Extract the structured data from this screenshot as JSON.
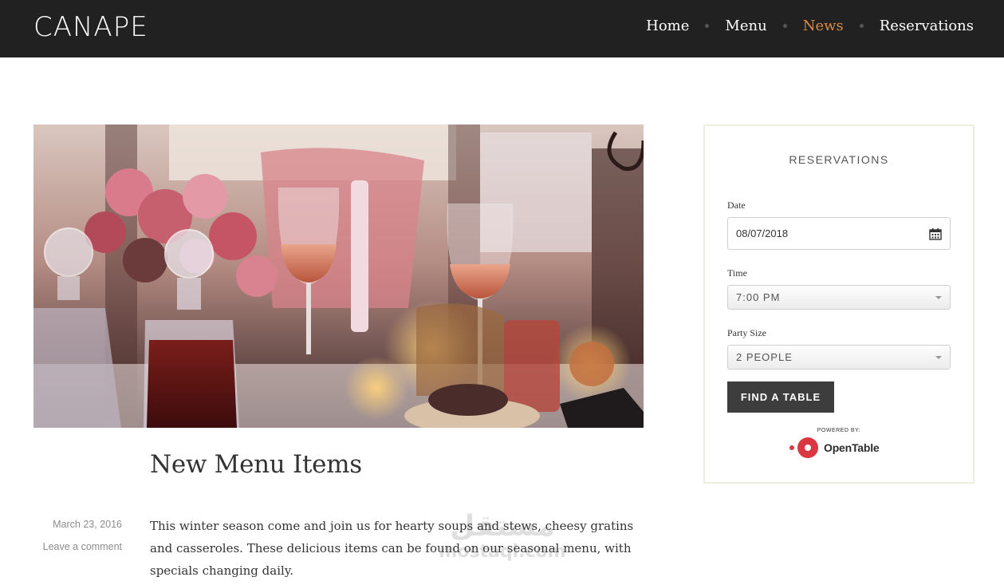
{
  "header": {
    "logo": "CANAPE",
    "nav": [
      {
        "label": "Home",
        "active": false
      },
      {
        "label": "Menu",
        "active": false
      },
      {
        "label": "News",
        "active": true
      },
      {
        "label": "Reservations",
        "active": false
      }
    ],
    "accent_color": "#d98c4a",
    "bar_color": "#222121"
  },
  "post": {
    "title": "New Menu Items",
    "date": "March 23, 2016",
    "comment_link": "Leave a comment",
    "excerpt": "This winter season come and join us for hearty soups and stews, cheesy gratins and casseroles. These delicious items can be found on our seasonal menu, with specials changing daily."
  },
  "reservations": {
    "title": "RESERVATIONS",
    "date_label": "Date",
    "date_value": "08/07/2018",
    "time_label": "Time",
    "time_value": "7:00 PM",
    "party_label": "Party Size",
    "party_value": "2 PEOPLE",
    "button_label": "FIND A TABLE",
    "powered_by": "POWERED BY:",
    "provider": "OpenTable",
    "icons": {
      "date": "calendar-icon",
      "select": "chevron-down-icon"
    }
  },
  "watermark": {
    "arabic": "مستقل",
    "latin": "mostaql.com"
  }
}
